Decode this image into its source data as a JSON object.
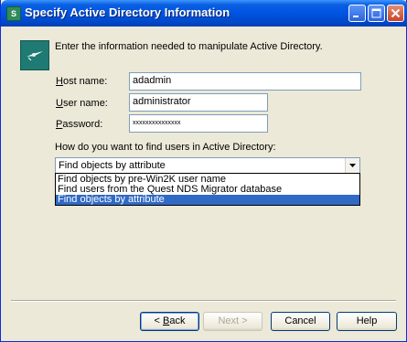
{
  "window": {
    "title": "Specify Active Directory Information",
    "app_icon_glyph": "S",
    "controls": {
      "minimize": "minimize-icon",
      "maximize": "maximize-icon",
      "close": "close-icon"
    }
  },
  "intro_text": "Enter the information needed to manipulate Active Directory.",
  "fields": {
    "host": {
      "label_key": "H",
      "label_rest": "ost name:",
      "value": "adadmin"
    },
    "user": {
      "label_key": "U",
      "label_rest": "ser name:",
      "value": "administrator"
    },
    "password": {
      "label_key": "P",
      "label_rest": "assword:",
      "value": "xxxxxxxxxxxxxxx"
    }
  },
  "find_users": {
    "question": "How do you want to find users in Active Directory:",
    "selected": "Find objects by attribute",
    "options": [
      "Find objects by pre-Win2K user name",
      "Find users from the Quest NDS Migrator database",
      "Find objects by attribute"
    ]
  },
  "buttons": {
    "back_key": "B",
    "back_prefix": "< ",
    "back_rest": "ack",
    "next": "Next >",
    "cancel": "Cancel",
    "help": "Help"
  }
}
